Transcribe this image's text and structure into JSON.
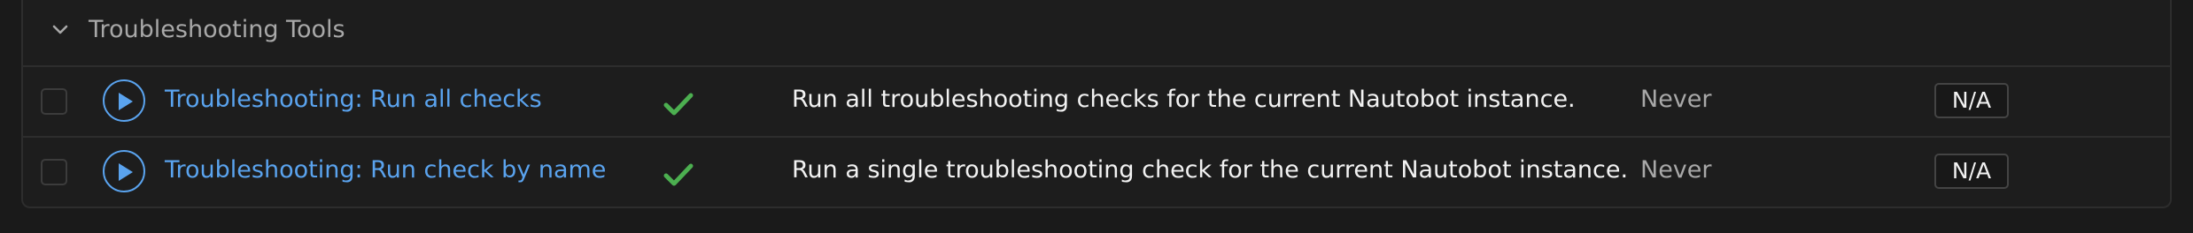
{
  "group": {
    "title": "Troubleshooting Tools",
    "expanded_icon": "chevron-down-icon"
  },
  "jobs": [
    {
      "name": "Troubleshooting: Run all checks",
      "enabled_icon": "checkmark-icon",
      "description": "Run all troubleshooting checks for the current Nautobot instance.",
      "last_run": "Never",
      "status": "N/A"
    },
    {
      "name": "Troubleshooting: Run check by name",
      "enabled_icon": "checkmark-icon",
      "description": "Run a single troubleshooting check for the current Nautobot instance.",
      "last_run": "Never",
      "status": "N/A"
    }
  ],
  "colors": {
    "link": "#5aa3ee",
    "enabled": "#4caf50",
    "background": "#1a1a1a"
  }
}
